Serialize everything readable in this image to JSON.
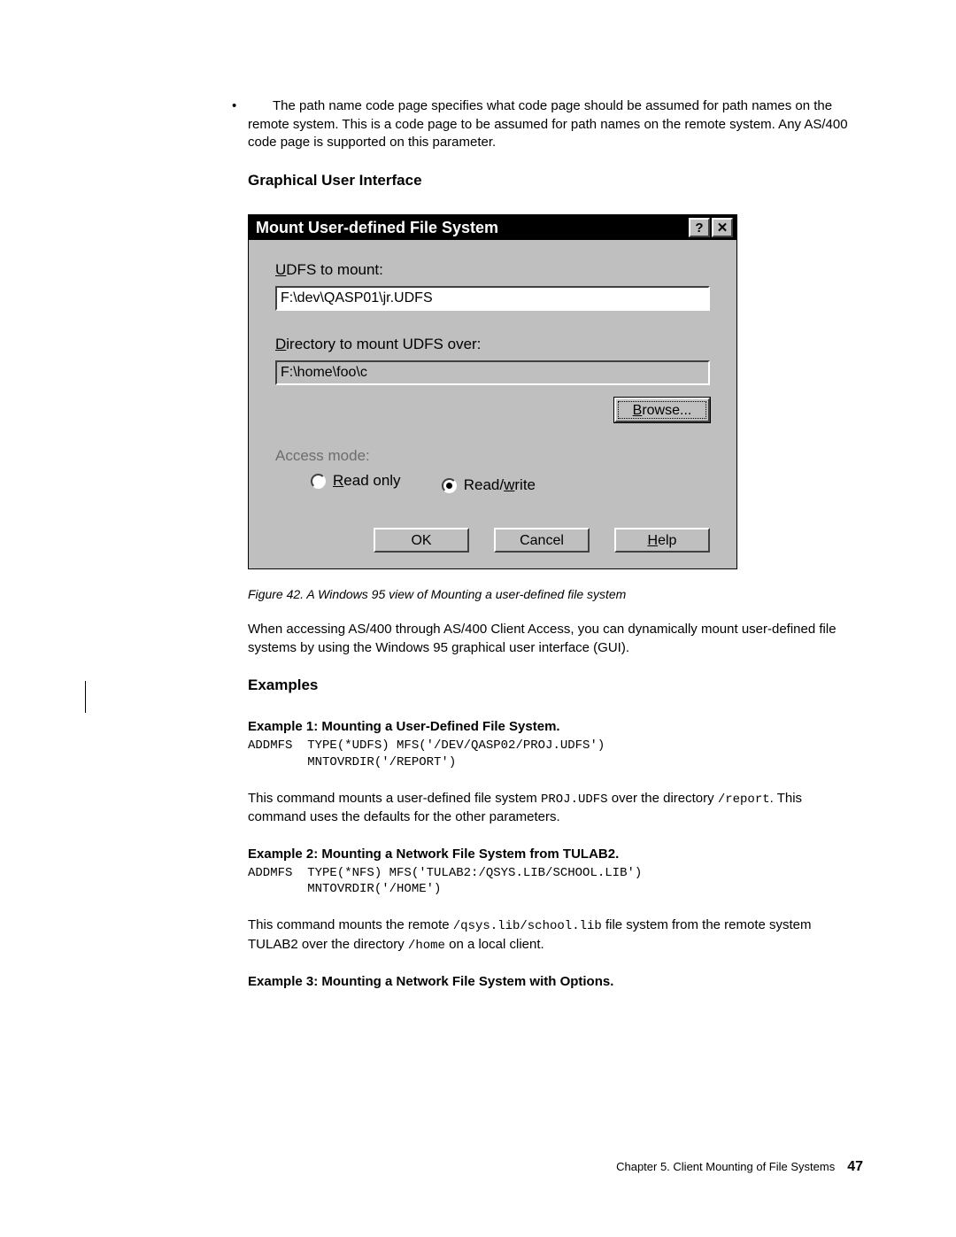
{
  "bullet": "The path name code page specifies what code page should be assumed for path names on the remote system. This is a code page to be assumed for path names on the remote system. Any AS/400 code page is supported on this parameter.",
  "heading_gui": "Graphical User Interface",
  "dialog": {
    "title": "Mount User-defined File System",
    "help_btn": "?",
    "close_btn": "✕",
    "udfs_label_u": "U",
    "udfs_label_r": "DFS to mount:",
    "udfs_value": "F:\\dev\\QASP01\\jr.UDFS",
    "dir_label_u": "D",
    "dir_label_r": "irectory to mount UDFS over:",
    "dir_value": "F:\\home\\foo\\c",
    "browse_u": "B",
    "browse_r": "rowse...",
    "access_label": "Access mode:",
    "read_only_u": "R",
    "read_only_r": "ead only",
    "read_write_p": "Read/",
    "read_write_u": "w",
    "read_write_r": "rite",
    "ok": "OK",
    "cancel": "Cancel",
    "help_u": "H",
    "help_r": "elp"
  },
  "caption": "Figure 42. A Windows 95 view of Mounting a user-defined file system",
  "para_access": "When accessing AS/400 through AS/400 Client Access, you can dynamically mount user-defined file systems by using the Windows 95 graphical user interface (GUI).",
  "heading_examples": "Examples",
  "ex1": {
    "head": "Example 1: Mounting a User-Defined File System",
    "code": "ADDMFS  TYPE(*UDFS) MFS('/DEV/QASP02/PROJ.UDFS')\n        MNTOVRDIR('/REPORT')",
    "desc_p1": "This command mounts a user-defined file system ",
    "desc_code1": "PROJ.UDFS",
    "desc_p2": " over the directory ",
    "desc_code2": "/report",
    "desc_p3": ". This command uses the defaults for the other parameters."
  },
  "ex2": {
    "head": "Example 2: Mounting a Network File System from TULAB2",
    "code": "ADDMFS  TYPE(*NFS) MFS('TULAB2:/QSYS.LIB/SCHOOL.LIB')\n        MNTOVRDIR('/HOME')",
    "desc_p1": "This command mounts the remote ",
    "desc_code1": "/qsys.lib/school.lib",
    "desc_p2": " file system from the remote system TULAB2 over the directory ",
    "desc_code2": "/home",
    "desc_p3": " on a local client."
  },
  "ex3": {
    "head": "Example 3: Mounting a Network File System with Options"
  },
  "footer": {
    "chapter": "Chapter 5. Client Mounting of File Systems",
    "page": "47"
  }
}
